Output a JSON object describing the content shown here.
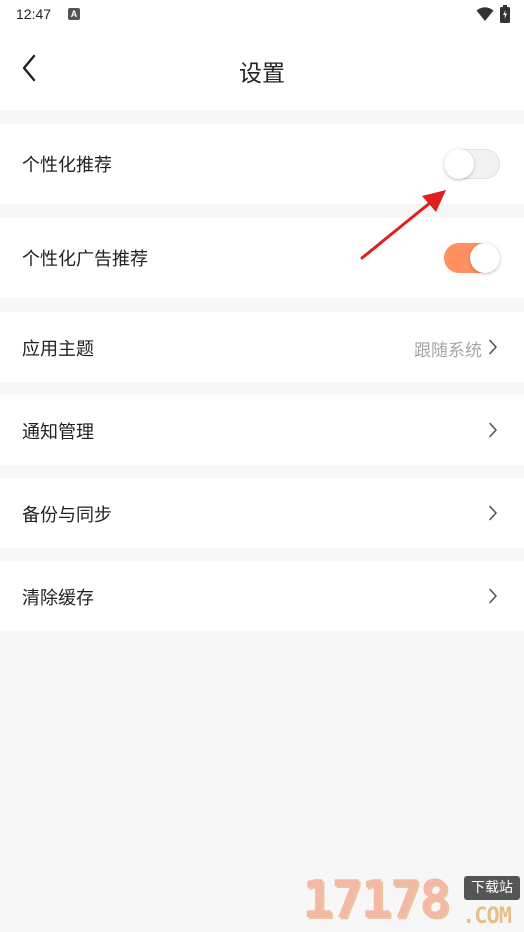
{
  "status_bar": {
    "time": "12:47",
    "indicator": "A",
    "icons": [
      "wifi-icon",
      "battery-icon"
    ]
  },
  "header": {
    "title": "设置",
    "back_icon": "chevron-left-icon"
  },
  "settings": {
    "personalized_recommend": {
      "label": "个性化推荐",
      "toggle_on": false
    },
    "personalized_ads": {
      "label": "个性化广告推荐",
      "toggle_on": true
    },
    "app_theme": {
      "label": "应用主题",
      "value": "跟随系统"
    },
    "notifications": {
      "label": "通知管理"
    },
    "backup_sync": {
      "label": "备份与同步"
    },
    "clear_cache": {
      "label": "清除缓存"
    }
  },
  "colors": {
    "toggle_on": "#ff9060",
    "toggle_off": "#f2f2f2",
    "annotation_arrow": "#e02020",
    "page_background": "#f7f7f7"
  },
  "watermark": {
    "digits": "17178",
    "badge": "下载站",
    "suffix": ".COM"
  }
}
